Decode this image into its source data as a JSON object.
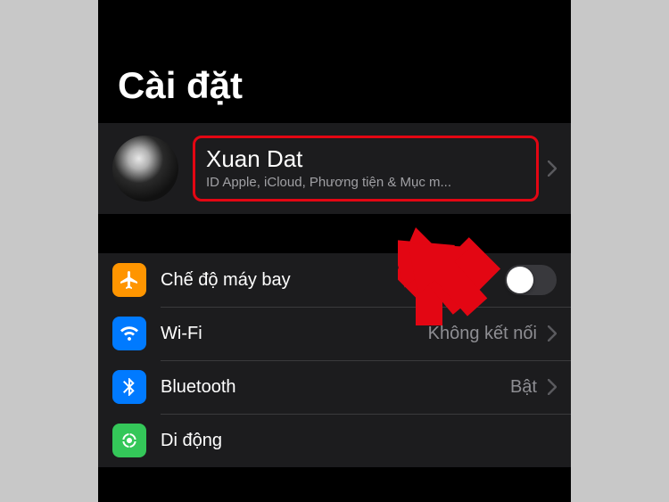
{
  "page_title": "Cài đặt",
  "profile": {
    "name": "Xuan Dat",
    "subtitle": "ID Apple, iCloud, Phương tiện & Mục m..."
  },
  "rows": {
    "airplane": {
      "label": "Chế độ máy bay"
    },
    "wifi": {
      "label": "Wi-Fi",
      "value": "Không kết nối"
    },
    "bluetooth": {
      "label": "Bluetooth",
      "value": "Bật"
    },
    "cellular": {
      "label": "Di động"
    }
  }
}
